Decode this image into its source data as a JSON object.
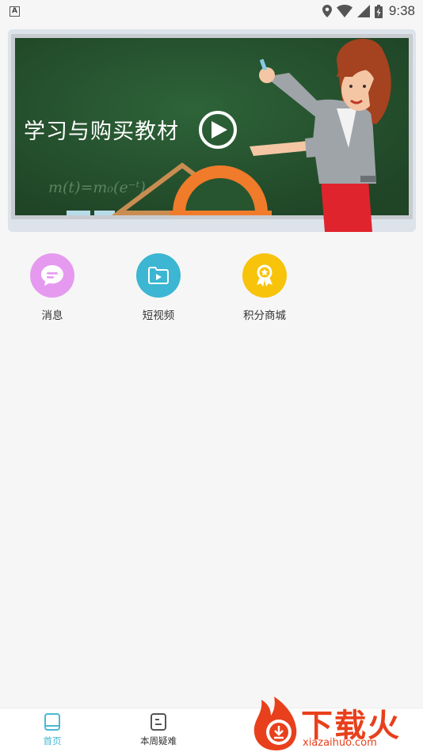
{
  "status_bar": {
    "app_indicator": "A",
    "time": "9:38",
    "icons": [
      "location-icon",
      "wifi-icon",
      "signal-icon",
      "battery-icon"
    ]
  },
  "banner": {
    "title": "学习与购买教材",
    "board_formula": "m(t)=m₀(e⁻ᵗ)"
  },
  "menu": {
    "items": [
      {
        "label": "消息",
        "icon": "message-icon",
        "color": "#e59af0"
      },
      {
        "label": "短视频",
        "icon": "video-folder-icon",
        "color": "#3cb6d2"
      },
      {
        "label": "积分商城",
        "icon": "award-icon",
        "color": "#f7c30b"
      }
    ]
  },
  "bottom_nav": {
    "items": [
      {
        "label": "首页",
        "icon": "book-icon",
        "active": true
      },
      {
        "label": "本周疑难",
        "icon": "note-icon",
        "active": false
      },
      {
        "label": "",
        "icon": "partial-icon",
        "active": false
      }
    ]
  },
  "watermark": {
    "brand": "下载火",
    "url": "xiazaihuo.com"
  },
  "colors": {
    "accent": "#4ab9d4",
    "board": "#27552f",
    "watermark": "#e8401c"
  }
}
